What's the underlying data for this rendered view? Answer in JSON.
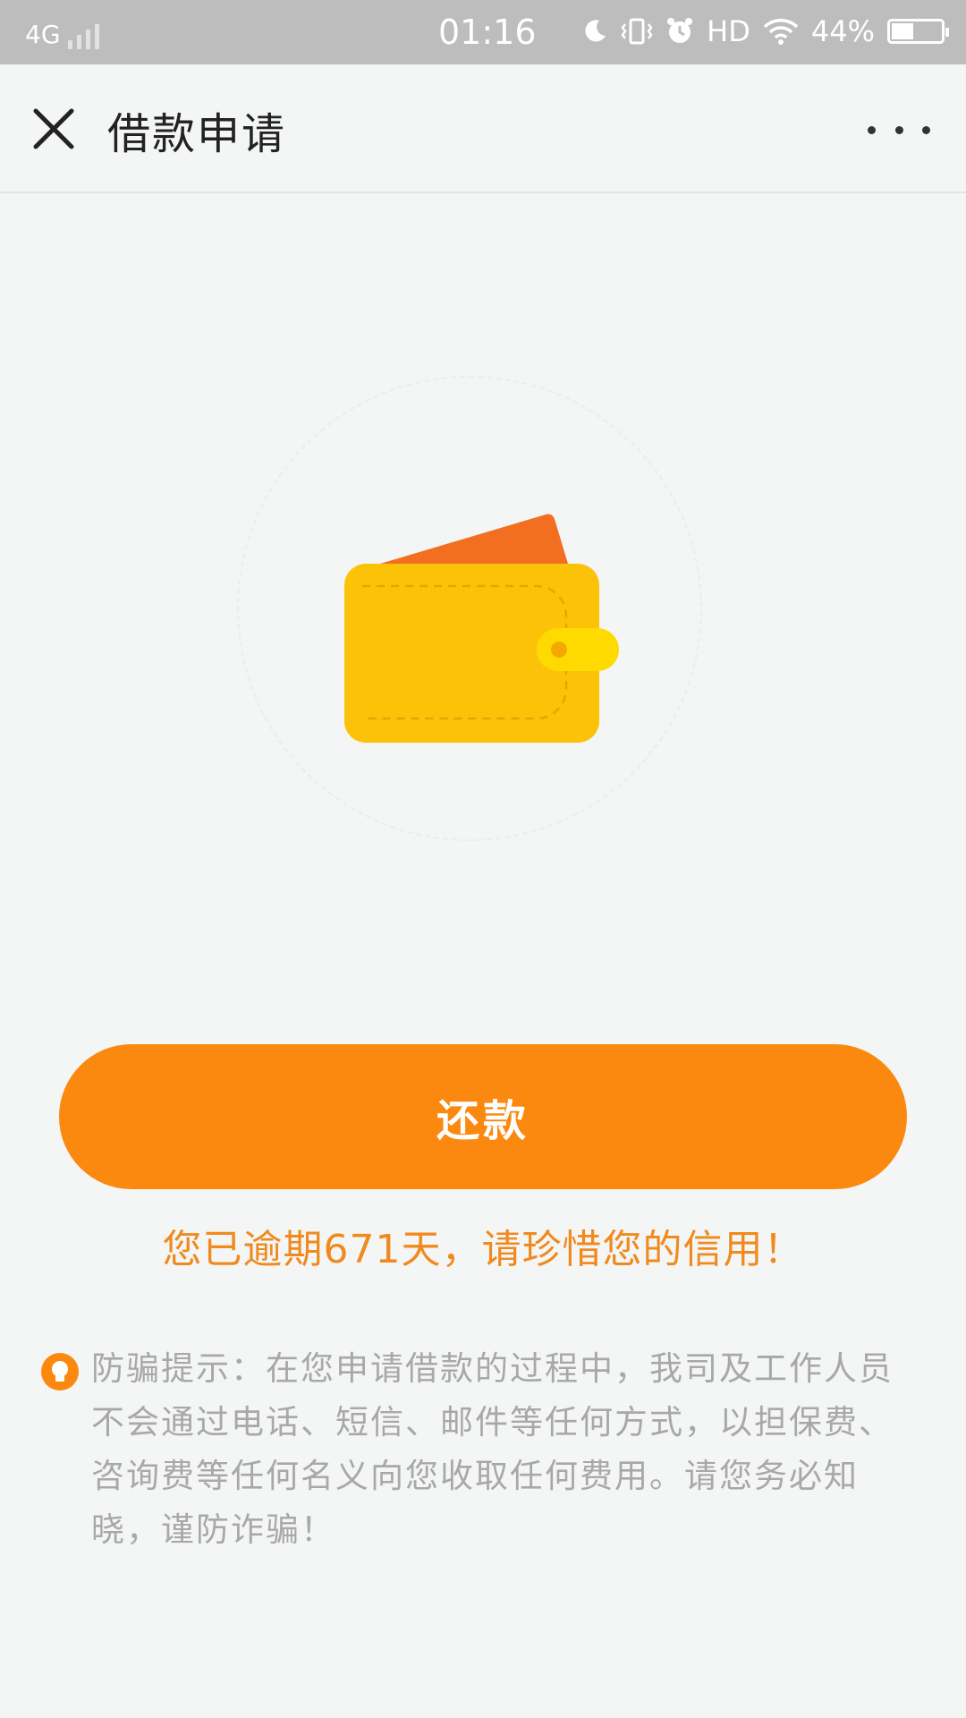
{
  "status_bar": {
    "network": "4G",
    "time": "01:16",
    "hd_label": "HD",
    "battery_percent": "44%",
    "battery_level": 0.44
  },
  "nav": {
    "title": "借款申请"
  },
  "main": {
    "repay_button_label": "还款",
    "overdue_message": "您已逾期671天，请珍惜您的信用！"
  },
  "tip": {
    "text": "防骗提示：在您申请借款的过程中，我司及工作人员不会通过电话、短信、邮件等任何方式，以担保费、咨询费等任何名义向您收取任何费用。请您务必知晓，谨防诈骗！"
  },
  "colors": {
    "accent": "#fb8910",
    "overdue_text": "#f08a1f",
    "wallet_body": "#fcc208",
    "wallet_card": "#f26f22",
    "wallet_clasp": "#ffda00"
  },
  "icons": {
    "close": "close-icon",
    "more": "more-icon",
    "wallet": "wallet-icon",
    "tip": "lightbulb-icon"
  }
}
